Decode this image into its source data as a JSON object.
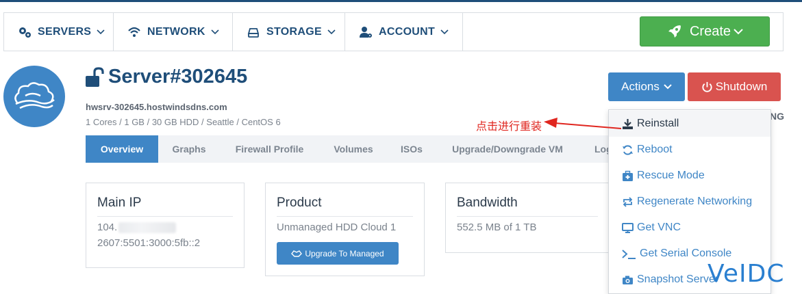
{
  "nav": {
    "items": [
      {
        "label": "SERVERS",
        "icon": "gears-icon"
      },
      {
        "label": "NETWORK",
        "icon": "wifi-icon"
      },
      {
        "label": "STORAGE",
        "icon": "hdd-icon"
      },
      {
        "label": "ACCOUNT",
        "icon": "user-gear-icon"
      }
    ],
    "create_label": "Create"
  },
  "server": {
    "title": "Server#302645",
    "hostname": "hwsrv-302645.hostwindsdns.com",
    "specs": "1 Cores / 1 GB / 30 GB HDD / Seattle / CentOS 6",
    "status_fragment": "NG"
  },
  "buttons": {
    "actions": "Actions",
    "shutdown": "Shutdown"
  },
  "tabs": [
    "Overview",
    "Graphs",
    "Firewall Profile",
    "Volumes",
    "ISOs",
    "Upgrade/Downgrade VM",
    "Log"
  ],
  "cards": {
    "main_ip": {
      "title": "Main IP",
      "ipv4_prefix": "104.",
      "ipv6": "2607:5501:3000:5fb::2"
    },
    "product": {
      "title": "Product",
      "value": "Unmanaged HDD Cloud 1",
      "button": "Upgrade To Managed"
    },
    "bandwidth": {
      "title": "Bandwidth",
      "value": "552.5 MB of 1 TB"
    }
  },
  "dropdown": {
    "items": [
      {
        "label": "Reinstall",
        "icon": "download-icon"
      },
      {
        "label": "Reboot",
        "icon": "refresh-icon"
      },
      {
        "label": "Rescue Mode",
        "icon": "medkit-icon"
      },
      {
        "label": "Regenerate Networking",
        "icon": "retweet-icon"
      },
      {
        "label": "Get VNC",
        "icon": "monitor-icon"
      },
      {
        "label": "Get Serial Console",
        "icon": "terminal-icon"
      },
      {
        "label": "Snapshot Server",
        "icon": "camera-icon"
      }
    ]
  },
  "annotation": {
    "text": "点击进行重装"
  },
  "watermark": {
    "text": "VeIDC"
  },
  "colors": {
    "brand_dark": "#1f4e79",
    "primary": "#3f86c6",
    "success": "#4caf50",
    "danger": "#d9534f",
    "annotation": "#e0261f"
  }
}
